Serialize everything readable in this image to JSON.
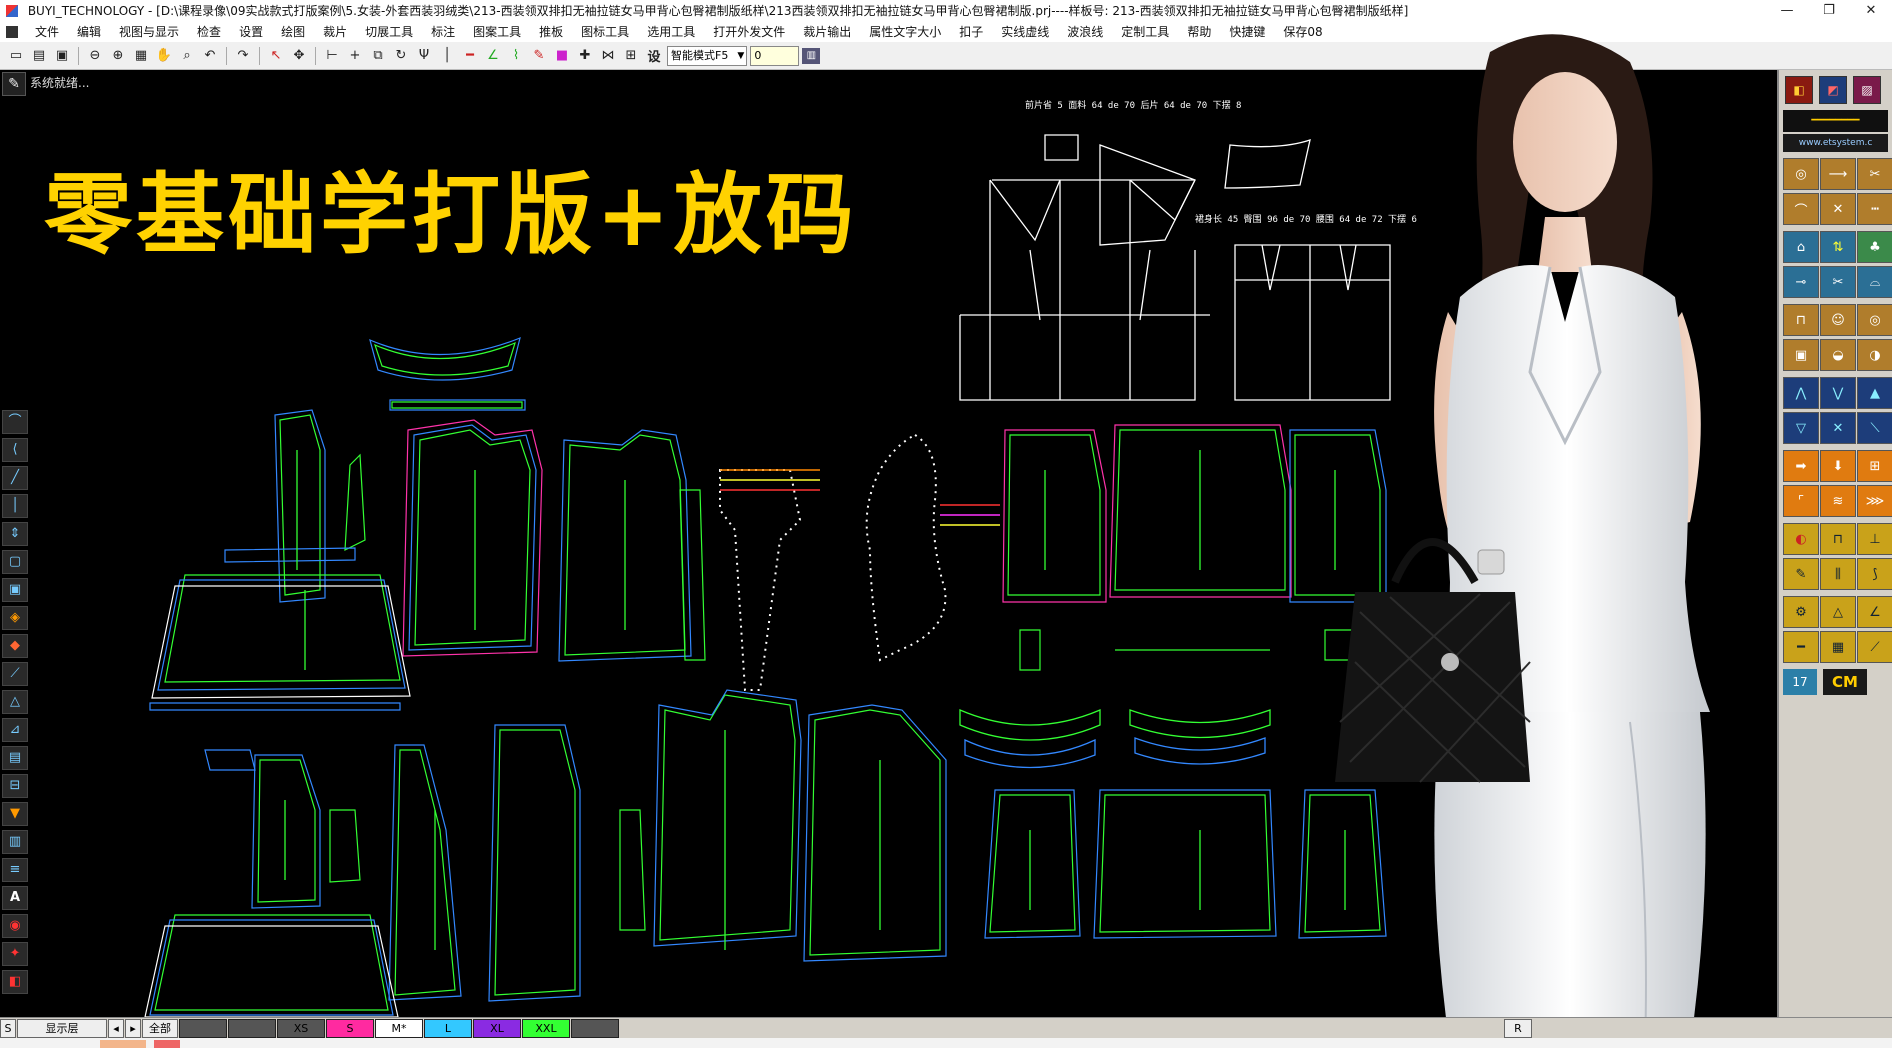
{
  "titlebar": {
    "title": "BUYI_TECHNOLOGY - [D:\\课程录像\\09实战款式打版案例\\5.女装-外套西装羽绒类\\213-西装领双排扣无袖拉链女马甲背心包臀裙制版纸样\\213西装领双排扣无袖拉链女马甲背心包臀裙制版.prj----样板号: 213-西装领双排扣无袖拉链女马甲背心包臀裙制版纸样]",
    "minimize": "—",
    "restore": "❐",
    "close": "✕"
  },
  "menubar": {
    "items": [
      "文件",
      "编辑",
      "视图与显示",
      "检查",
      "设置",
      "绘图",
      "裁片",
      "切展工具",
      "标注",
      "图案工具",
      "推板",
      "图标工具",
      "选用工具",
      "打开外发文件",
      "裁片输出",
      "属性文字大小",
      "扣子",
      "实线虚线",
      "波浪线",
      "定制工具",
      "帮助",
      "快捷键",
      "保存08"
    ]
  },
  "toolbar": {
    "mode_label": "设",
    "mode_select": "智能模式F5",
    "value_input": "0"
  },
  "status": {
    "message": "系统就绪..."
  },
  "canvas": {
    "headline": "零基础学打版+放码",
    "draft_labels": [
      "前片省 5   面料 64 de 70   后片 64 de 70   下摆 8",
      "裙身长 45   臀围 96 de 70   腰围 64 de 72   下摆 6"
    ]
  },
  "right_panel": {
    "brand": "━━━━━━━━",
    "url": "www.etsystem.c",
    "num_badge": "17",
    "unit": "CM"
  },
  "sizebar": {
    "s_label": "S",
    "layer_label": "显示层",
    "all_label": "全部",
    "r_label": "R",
    "sizes": [
      {
        "label": "",
        "color": "#555555"
      },
      {
        "label": "",
        "color": "#555555"
      },
      {
        "label": "XS",
        "color": "#555555"
      },
      {
        "label": "S",
        "color": "#ff2aa0"
      },
      {
        "label": "M*",
        "color": "#ffffff"
      },
      {
        "label": "L",
        "color": "#33c8ff"
      },
      {
        "label": "XL",
        "color": "#8a2be2"
      },
      {
        "label": "XXL",
        "color": "#33ff33"
      },
      {
        "label": "",
        "color": "#555555"
      }
    ]
  }
}
